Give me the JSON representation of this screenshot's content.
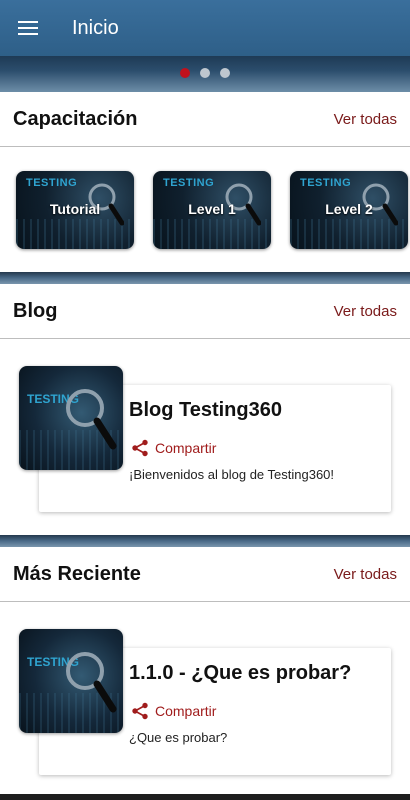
{
  "appbar": {
    "title": "Inicio",
    "menu_icon": "hamburger-menu-icon"
  },
  "carousel": {
    "pages": 3,
    "active_index": 0,
    "active_color": "#c0111c"
  },
  "training": {
    "title": "Capacitación",
    "see_all": "Ver todas",
    "items": [
      {
        "label": "Tutorial",
        "badge": "TESTING"
      },
      {
        "label": "Level 1",
        "badge": "TESTING"
      },
      {
        "label": "Level 2",
        "badge": "TESTING"
      }
    ]
  },
  "blog": {
    "title": "Blog",
    "see_all": "Ver todas",
    "card": {
      "title": "Blog Testing360",
      "share_label": "Compartir",
      "description": "¡Bienvenidos al blog de Testing360!",
      "thumb_badge": "TESTING"
    }
  },
  "recent": {
    "title": "Más Reciente",
    "see_all": "Ver todas",
    "card": {
      "title": "1.1.0 - ¿Que es probar?",
      "share_label": "Compartir",
      "description": "¿Que es probar?",
      "thumb_badge": "TESTING"
    }
  },
  "colors": {
    "appbar": "#2e5f88",
    "accent_red": "#a01c1c",
    "link": "#7a1a1a"
  }
}
